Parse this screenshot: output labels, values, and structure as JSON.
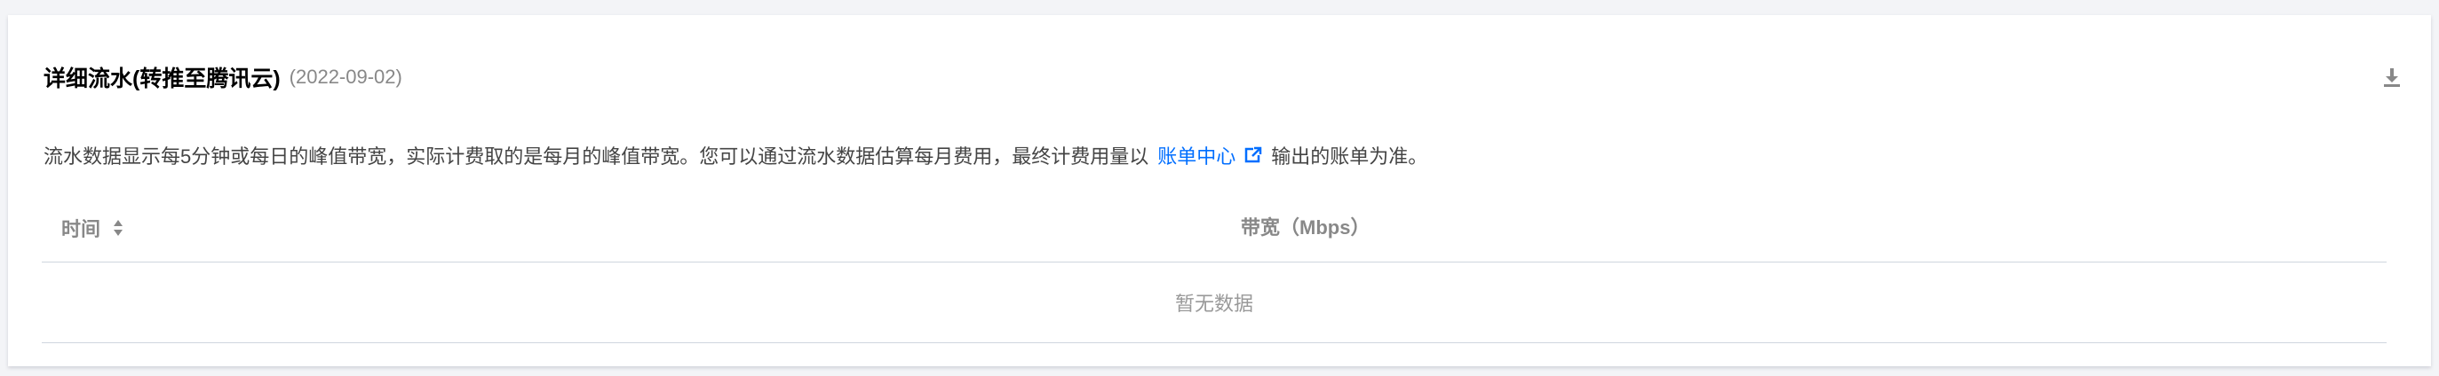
{
  "panel": {
    "title": "详细流水(转推至腾讯云)",
    "date": "(2022-09-02)",
    "download_icon": "download-icon"
  },
  "description": {
    "before_link": "流水数据显示每5分钟或每日的峰值带宽，实际计费取的是每月的峰值带宽。您可以通过流水数据估算每月费用，最终计费用量以",
    "link_text": "账单中心",
    "link_icon": "external-link-icon",
    "after_link": "输出的账单为准。"
  },
  "table": {
    "columns": [
      "时间",
      "带宽（Mbps）"
    ],
    "sort_icon": "sort-icon",
    "empty_text": "暂无数据"
  },
  "colors": {
    "link": "#006eff",
    "border": "#cfd5de",
    "muted": "#888888"
  }
}
